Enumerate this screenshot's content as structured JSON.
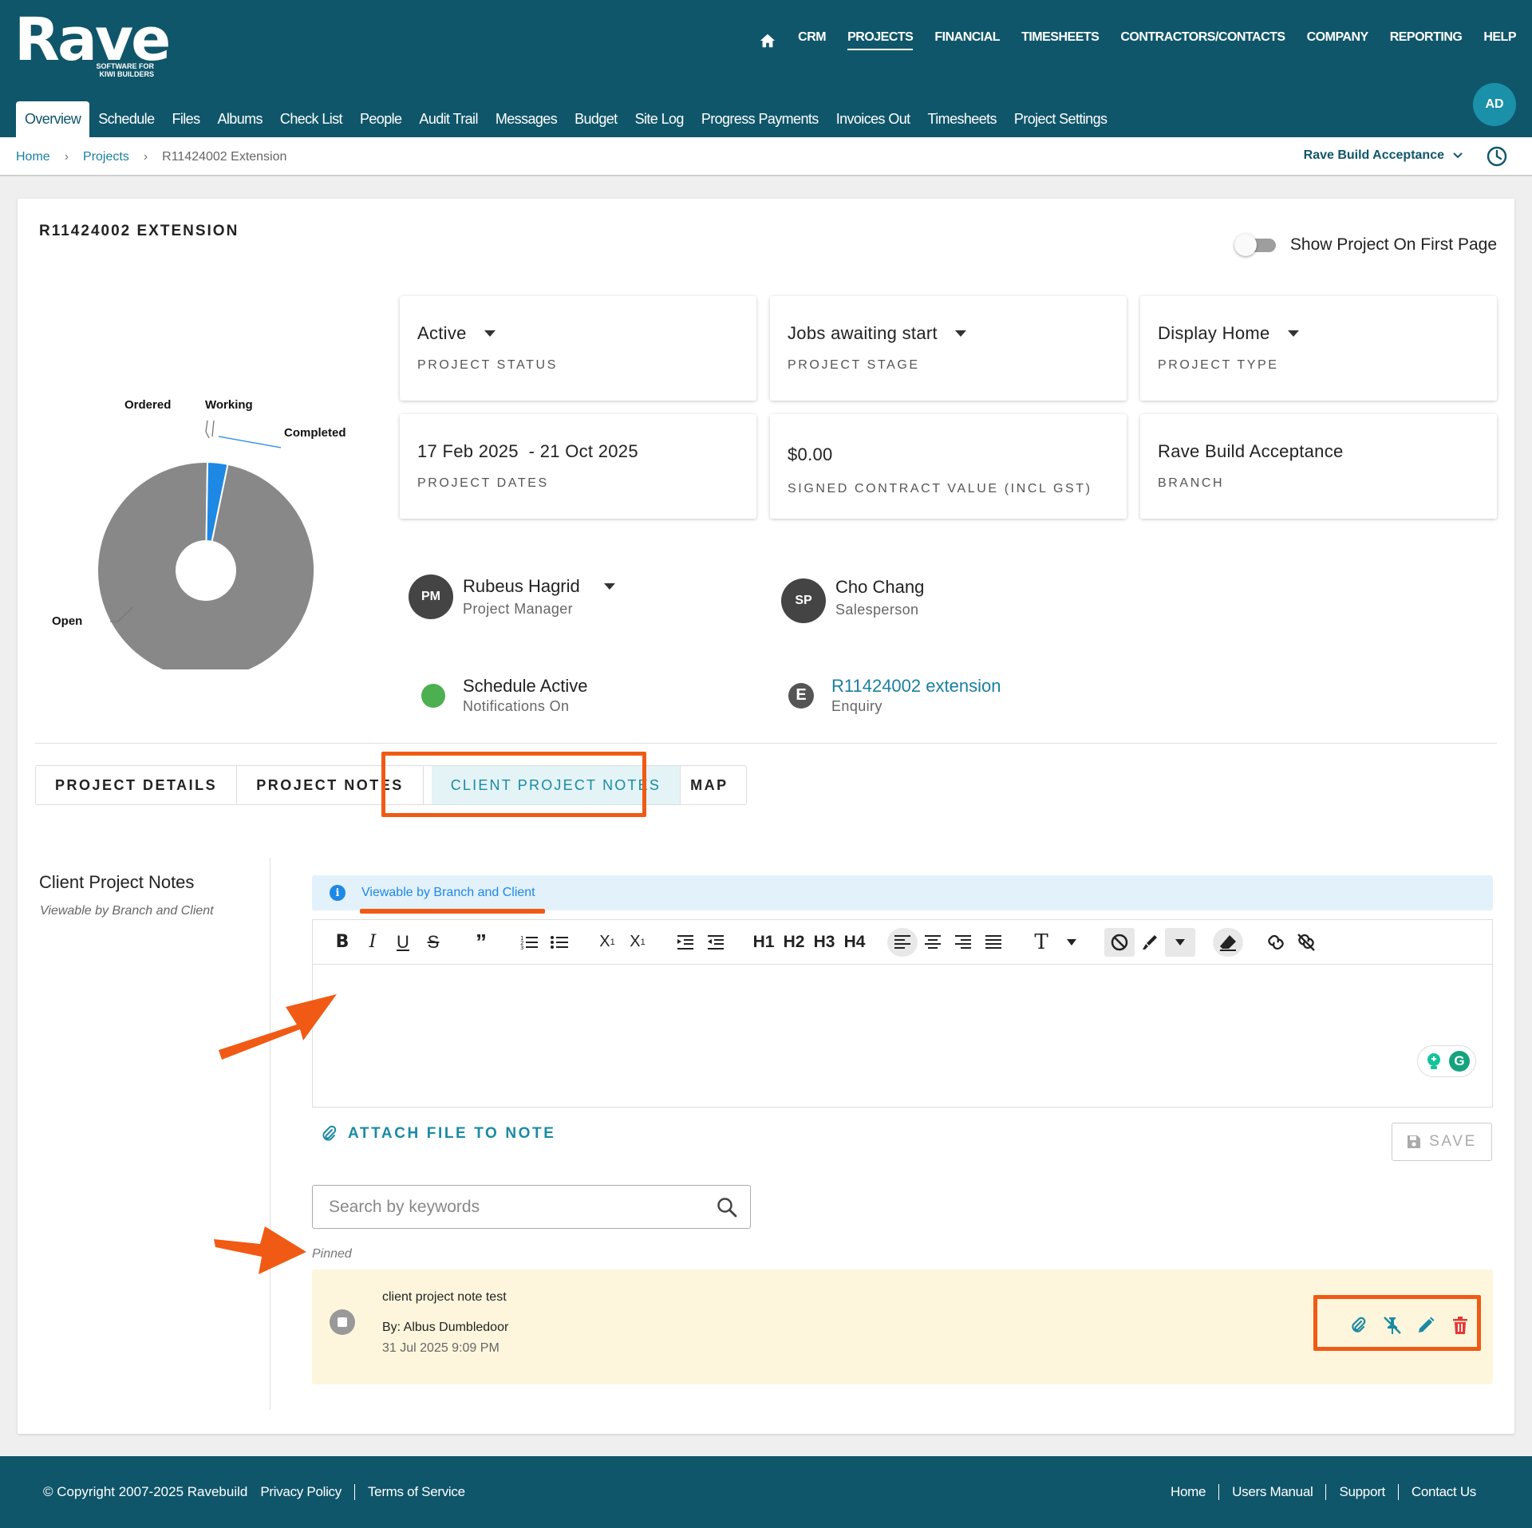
{
  "header": {
    "logo_word": "Rave",
    "logo_tagline_1": "SOFTWARE FOR",
    "logo_tagline_2": "KIWI BUILDERS",
    "nav": [
      "CRM",
      "PROJECTS",
      "FINANCIAL",
      "TIMESHEETS",
      "CONTRACTORS/CONTACTS",
      "COMPANY",
      "REPORTING",
      "HELP"
    ],
    "active_nav": "PROJECTS",
    "subnav": [
      "Overview",
      "Schedule",
      "Files",
      "Albums",
      "Check List",
      "People",
      "Audit Trail",
      "Messages",
      "Budget",
      "Site Log",
      "Progress Payments",
      "Invoices Out",
      "Timesheets",
      "Project Settings"
    ],
    "active_subnav": "Overview",
    "user_initials": "AD"
  },
  "breadcrumb": {
    "home": "Home",
    "projects": "Projects",
    "current": "R11424002 Extension",
    "branch": "Rave Build Acceptance"
  },
  "project": {
    "title": "R11424002 EXTENSION",
    "show_first_page_label": "Show Project On First Page",
    "show_first_page": false,
    "cards": {
      "status": {
        "value": "Active",
        "label": "PROJECT STATUS"
      },
      "stage": {
        "value": "Jobs awaiting start",
        "label": "PROJECT STAGE"
      },
      "type": {
        "value": "Display Home",
        "label": "PROJECT TYPE"
      },
      "dates": {
        "value": "17 Feb 2025  - 21 Oct 2025",
        "label": "PROJECT DATES"
      },
      "contract": {
        "value": "$0.00",
        "label": "SIGNED CONTRACT VALUE (INCL GST)"
      },
      "branch": {
        "value": "Rave Build Acceptance",
        "label": "BRANCH"
      }
    },
    "manager": {
      "initials": "PM",
      "name": "Rubeus Hagrid",
      "role": "Project Manager"
    },
    "salesperson": {
      "initials": "SP",
      "name": "Cho Chang",
      "role": "Salesperson"
    },
    "schedule": {
      "title": "Schedule Active",
      "sub": "Notifications On"
    },
    "enquiry": {
      "icon_letter": "E",
      "link": "R11424002 extension",
      "sub": "Enquiry"
    }
  },
  "chart_data": {
    "type": "pie",
    "categories": [
      "Open",
      "Ordered",
      "Working",
      "Completed"
    ],
    "values": [
      97,
      0,
      3,
      0
    ],
    "colors": {
      "Open": "#888888",
      "Ordered": "#888888",
      "Working": "#1e88e5",
      "Completed": "#888888"
    },
    "donut": true
  },
  "tabs": {
    "items": [
      "PROJECT DETAILS",
      "PROJECT NOTES",
      "CLIENT PROJECT NOTES",
      "MAP"
    ],
    "active": "CLIENT PROJECT NOTES"
  },
  "notes": {
    "side_title": "Client Project Notes",
    "side_sub": "Viewable by Branch and Client",
    "banner": "Viewable by Branch and Client",
    "attach_label": "ATTACH FILE TO NOTE",
    "save_label": "SAVE",
    "search_placeholder": "Search by keywords",
    "pinned_label": "Pinned",
    "pinned_note": {
      "text": "client project note test",
      "author": "By: Albus Dumbledoor",
      "date": "31 Jul 2025 9:09 PM"
    },
    "toolbar_headings": [
      "H1",
      "H2",
      "H3",
      "H4"
    ]
  },
  "footer": {
    "copyright": "© Copyright 2007-2025 Ravebuild",
    "privacy": "Privacy Policy",
    "terms": "Terms of Service",
    "right_links": [
      "Home",
      "Users Manual",
      "Support",
      "Contact Us"
    ]
  },
  "colors": {
    "brand": "#10566a",
    "accent": "#1a8aa3",
    "highlight": "#f05a14",
    "pinned_bg": "#fdf6dd"
  }
}
